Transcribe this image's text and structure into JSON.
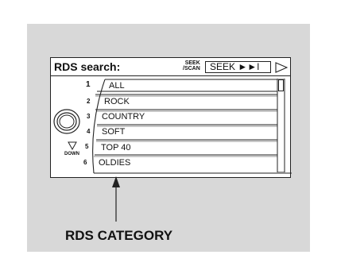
{
  "screen": {
    "title": "RDS search:",
    "seek_small_line1": "SEEK",
    "seek_small_line2": "/SCAN",
    "seek_button_label": "SEEK ►►I",
    "play_icon": "outline-triangle-right-icon",
    "down_label": "DOWN",
    "knob_icon": "rotary-knob-icon"
  },
  "list": {
    "items": [
      {
        "number": "1",
        "label": "ALL",
        "selected": true
      },
      {
        "number": "2",
        "label": "ROCK",
        "selected": false
      },
      {
        "number": "3",
        "label": "COUNTRY",
        "selected": false
      },
      {
        "number": "4",
        "label": "SOFT",
        "selected": false
      },
      {
        "number": "5",
        "label": "TOP 40",
        "selected": false
      },
      {
        "number": "6",
        "label": "OLDIES",
        "selected": false
      }
    ]
  },
  "callout": {
    "label": "RDS CATEGORY"
  },
  "colors": {
    "panel_background": "#d8d8d8",
    "screen_background": "#ffffff",
    "line": "#222222"
  }
}
